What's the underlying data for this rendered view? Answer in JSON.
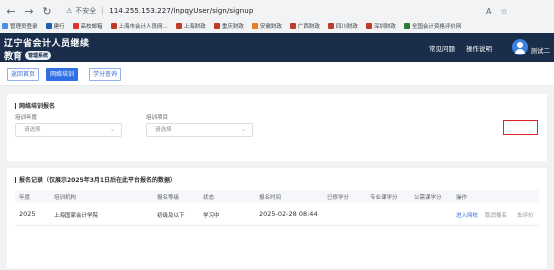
{
  "browser": {
    "insecure_label": "不安全",
    "url": "114.255.153.227/lnpqyUser/sign/signup",
    "font_size_label": "A",
    "bookmarks": [
      {
        "label": "管理员登录",
        "color": "#4a90e2"
      },
      {
        "label": "建行",
        "color": "#1e5fb4"
      },
      {
        "label": "高校邮箱",
        "color": "#d9342b"
      },
      {
        "label": "上海市会计人员网...",
        "color": "#c0392b"
      },
      {
        "label": "上海财政",
        "color": "#c0392b"
      },
      {
        "label": "重庆财政",
        "color": "#c0392b"
      },
      {
        "label": "安徽财政",
        "color": "#e67e22"
      },
      {
        "label": "广西财政",
        "color": "#c0392b"
      },
      {
        "label": "四川财政",
        "color": "#c0392b"
      },
      {
        "label": "深圳财政",
        "color": "#c0392b"
      },
      {
        "label": "全国会计资格评价网",
        "color": "#2e7d32"
      }
    ]
  },
  "header": {
    "brand_line1": "辽宁省会计人员继续",
    "brand_line2": "教育",
    "badge": "管理系统",
    "links": [
      "常见问题",
      "操作说明"
    ],
    "username": "测试二"
  },
  "tabs": [
    {
      "label": "返回首页",
      "active": false
    },
    {
      "label": "网络培训",
      "active": true
    },
    {
      "label": "学分查询",
      "active": false
    }
  ],
  "signup_section": {
    "title": "网络培训报名",
    "year_label": "培训年度",
    "year_placeholder": "请选择",
    "project_label": "培训项目",
    "project_placeholder": "请选择"
  },
  "records_section": {
    "title": "报名记录（仅展示2025年3月1日后在此平台报名的数据）",
    "columns": [
      "年度",
      "培训机构",
      "报名等级",
      "状态",
      "报名时间",
      "已修学分",
      "专业课学分",
      "公需课学分",
      "操作"
    ],
    "rows": [
      {
        "year": "2025",
        "institution": "上海国家会计学院",
        "level": "初级及以下",
        "status": "学习中",
        "signup_time": "2025-02-28 08:44",
        "earned_credits": "",
        "professional_credits": "",
        "public_credits": "",
        "actions": {
          "enter": "进入网校",
          "cancel": "取消报名",
          "evaluate": "去评价"
        }
      }
    ]
  },
  "colors": {
    "header_bg": "#1a2d4a",
    "primary": "#2f6fe4",
    "highlight_border": "#e0242a"
  }
}
